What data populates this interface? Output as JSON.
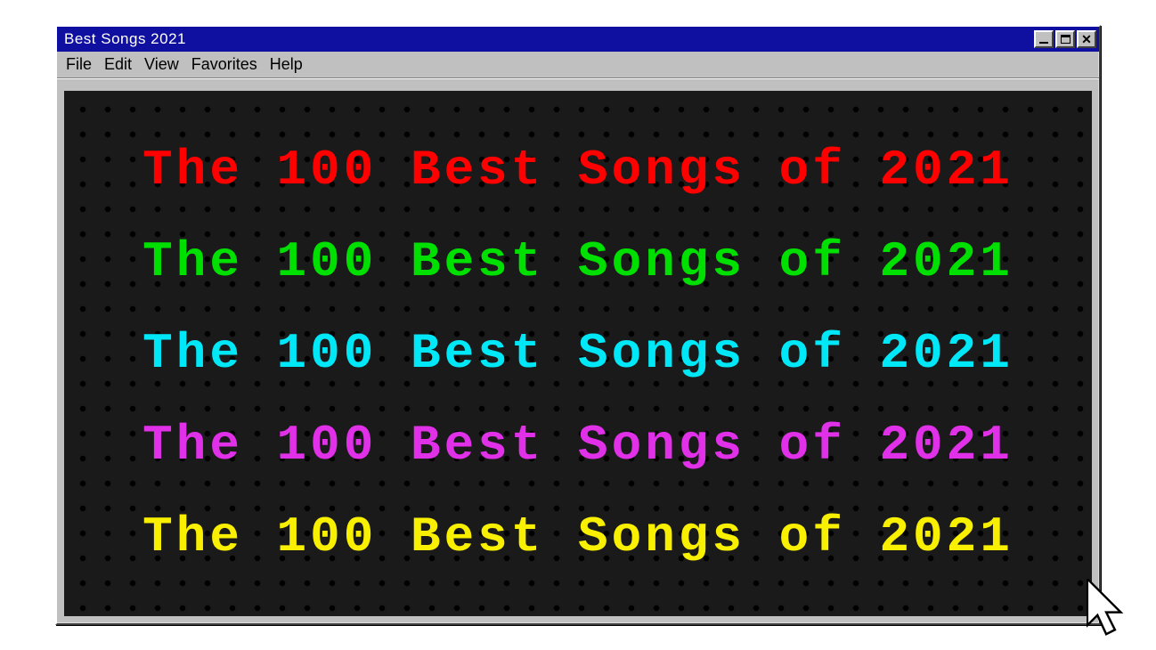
{
  "window": {
    "title": "Best Songs 2021"
  },
  "menu": {
    "items": [
      "File",
      "Edit",
      "View",
      "Favorites",
      "Help"
    ]
  },
  "content": {
    "headline_text": "The 100 Best Songs of 2021",
    "lines": [
      {
        "color": "#ff0000"
      },
      {
        "color": "#00e000"
      },
      {
        "color": "#00e8f8"
      },
      {
        "color": "#e030e8"
      },
      {
        "color": "#f8f000"
      }
    ]
  }
}
